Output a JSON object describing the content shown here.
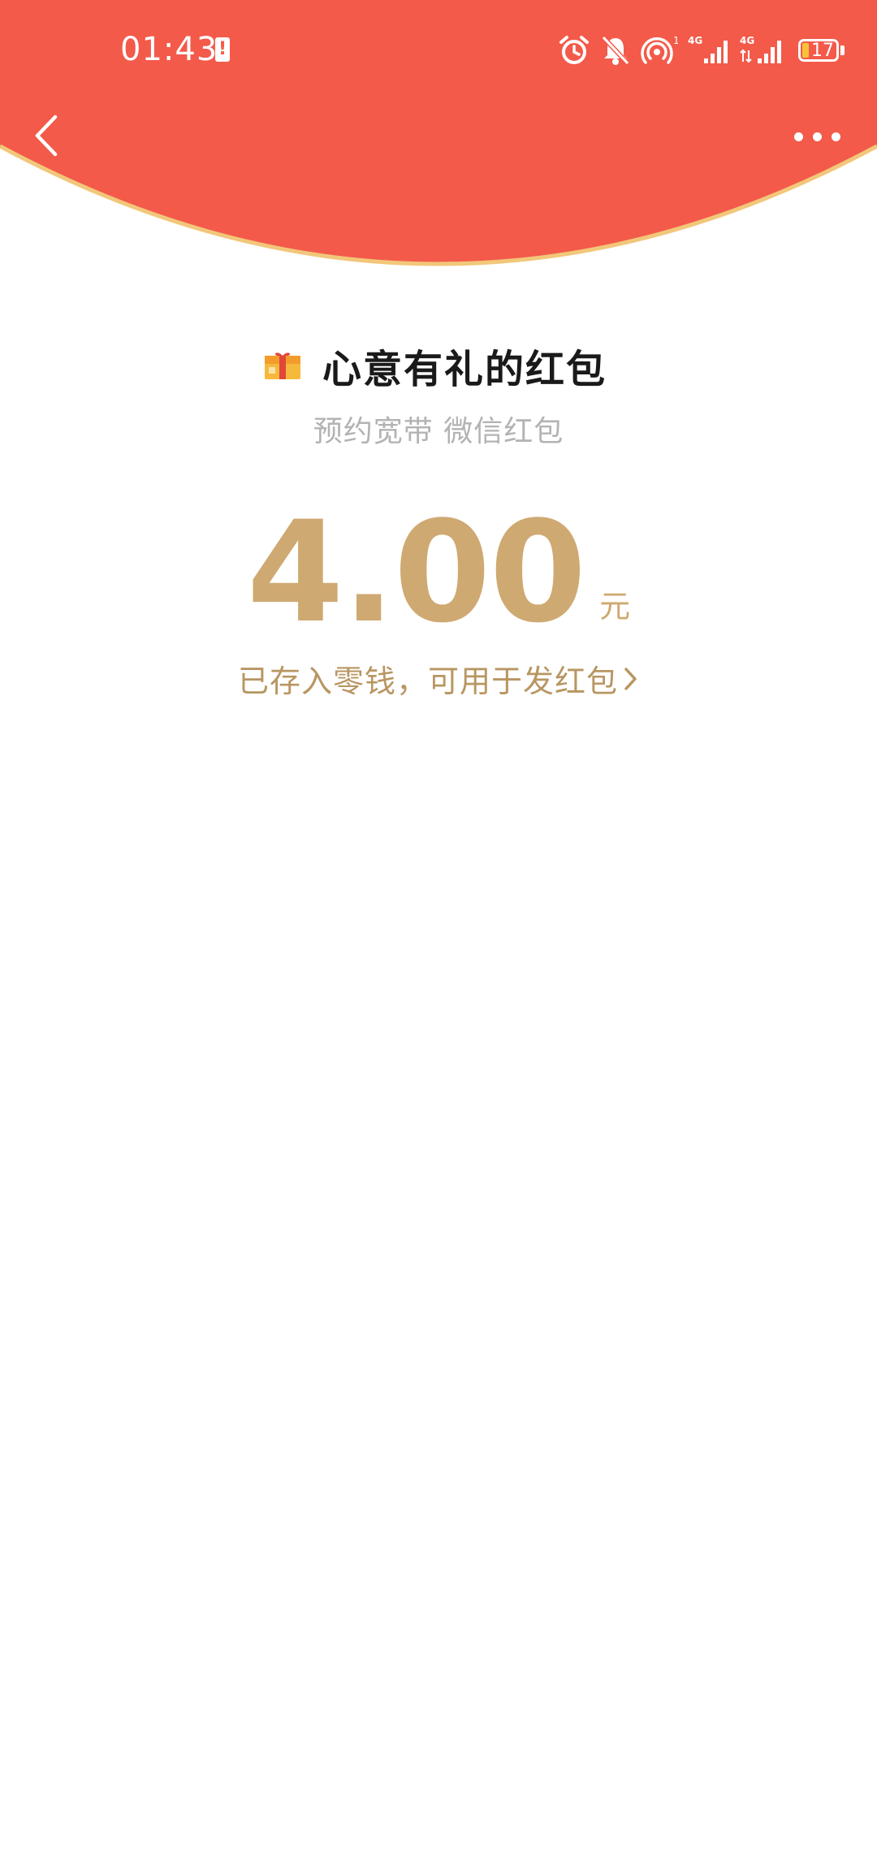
{
  "status_bar": {
    "time": "01:43",
    "battery_level": "17",
    "network_1": "4G",
    "network_2": "4G"
  },
  "colors": {
    "header_red": "#F35A4A",
    "header_edge": "#F2C77A",
    "amount_gold": "#CFA972",
    "link_gold": "#B89662",
    "subtitle_gray": "#B3B3B3"
  },
  "nav": {
    "back_icon": "chevron-left-icon",
    "more_icon": "more-dots-icon"
  },
  "packet": {
    "icon": "gift-box-icon",
    "title": "心意有礼的红包",
    "subtitle": "预约宽带 微信红包",
    "amount": "4.00",
    "unit": "元",
    "change_link_text": "已存入零钱，可用于发红包"
  }
}
